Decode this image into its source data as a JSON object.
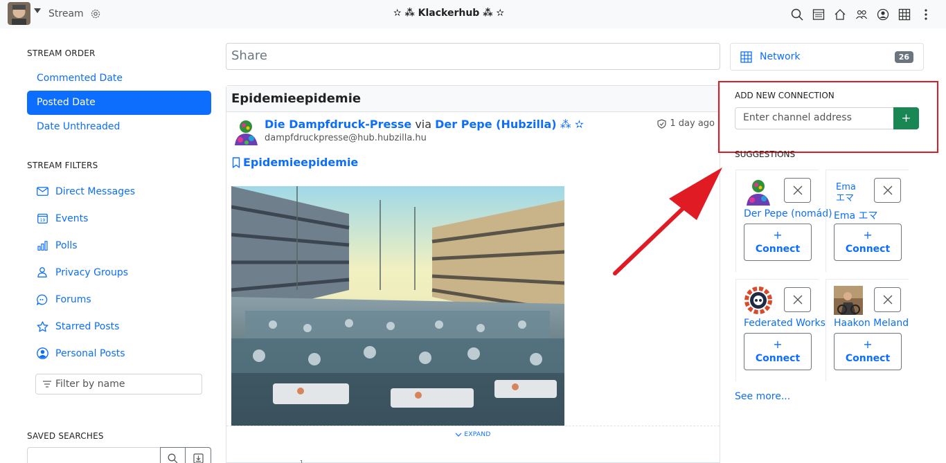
{
  "navbar": {
    "section": "Stream",
    "title": "✫ ⁂ Klackerhub ⁂ ✫"
  },
  "left": {
    "order_title": "STREAM ORDER",
    "order_items": [
      {
        "label": "Commented Date",
        "active": false
      },
      {
        "label": "Posted Date",
        "active": true
      },
      {
        "label": "Date Unthreaded",
        "active": false
      }
    ],
    "filters_title": "STREAM FILTERS",
    "filters": [
      {
        "label": "Direct Messages",
        "icon": "envelope-icon"
      },
      {
        "label": "Events",
        "icon": "calendar-icon"
      },
      {
        "label": "Polls",
        "icon": "bar-chart-icon"
      },
      {
        "label": "Privacy Groups",
        "icon": "person-icon"
      },
      {
        "label": "Forums",
        "icon": "chat-icon"
      },
      {
        "label": "Starred Posts",
        "icon": "star-icon"
      },
      {
        "label": "Personal Posts",
        "icon": "person-circle-icon"
      }
    ],
    "filter_placeholder": "Filter by name",
    "saved_title": "SAVED SEARCHES"
  },
  "center": {
    "share_placeholder": "Share",
    "post": {
      "title": "Epidemieepidemie",
      "author": "Die Dampfdruck-Presse",
      "via": "via",
      "via_author": "Der Pepe (Hubzilla)",
      "via_suffix": "⁂ ✫",
      "address": "dampfdruckpresse@hub.hubzilla.hu",
      "time": "1 day ago",
      "link_title": "Epidemieepidemie",
      "expand": "EXPAND",
      "tiny_mark": "1"
    }
  },
  "right": {
    "network_label": "Network",
    "network_count": "26",
    "add_title": "ADD NEW CONNECTION",
    "add_placeholder": "Enter channel address",
    "add_button": "+",
    "suggestions_title": "SUGGESTIONS",
    "suggestions": [
      {
        "name": "Der Pepe (nomád)",
        "connect": "Connect",
        "plus": "+",
        "alt": ""
      },
      {
        "name": "Ema エマ",
        "connect": "Connect",
        "plus": "+",
        "alt": "Ema エマ"
      },
      {
        "name": "Federated Works",
        "connect": "Connect",
        "plus": "+",
        "alt": ""
      },
      {
        "name": "Haakon Meland",
        "connect": "Connect",
        "plus": "+",
        "alt": ""
      }
    ],
    "see_more": "See more..."
  },
  "colors": {
    "primary": "#0d6efd",
    "success": "#198754",
    "highlight": "#e01b24"
  }
}
